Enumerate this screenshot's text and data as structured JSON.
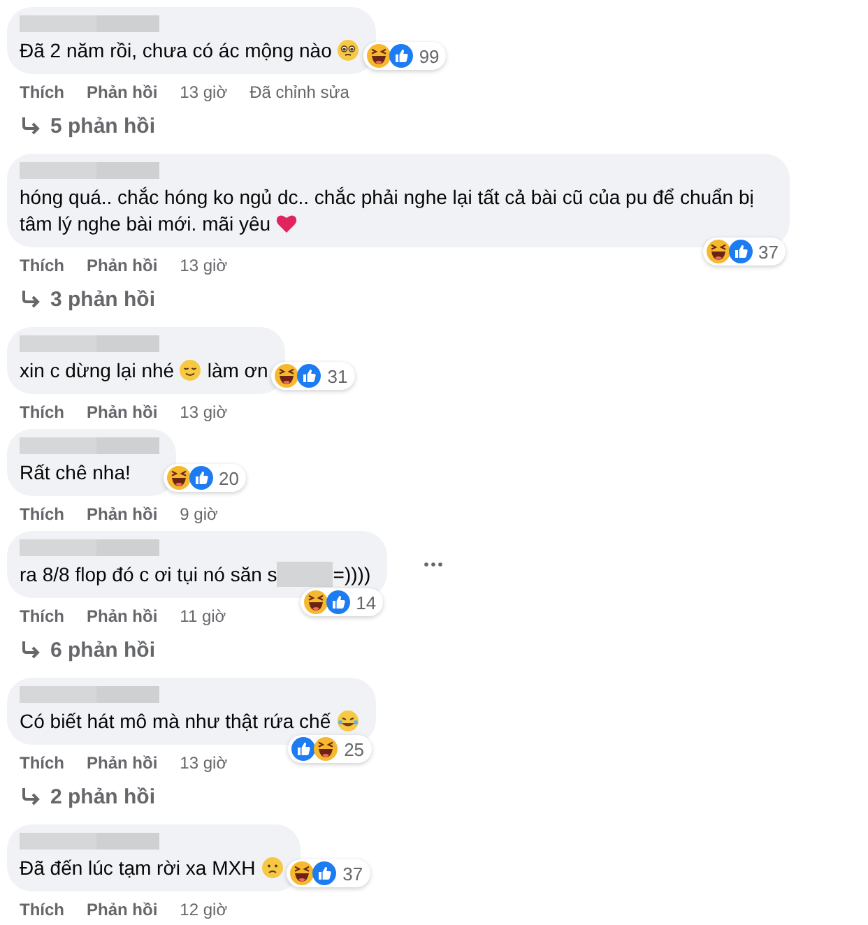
{
  "comments": [
    {
      "parts": [
        {
          "kind": "text",
          "text": "Đã 2 năm rồi, chưa có ác mộng nào "
        },
        {
          "kind": "teary"
        }
      ],
      "reactions": {
        "below": false,
        "icons": [
          {
            "kind": "haha"
          },
          {
            "kind": "like"
          }
        ],
        "count": "99"
      },
      "menu": false,
      "actions": [
        "Thích",
        "Phản hồi"
      ],
      "time": "13 giờ",
      "edited": "Đã chỉnh sửa",
      "replies": "5 phản hồi"
    },
    {
      "parts": [
        {
          "kind": "text",
          "text": "hóng quá.. chắc hóng ko ngủ dc.. chắc phải nghe lại tất cả bài cũ của pu để chuẩn bị "
        },
        {
          "kind": "text",
          "text": "tâm lý nghe bài mới. mãi yêu "
        },
        {
          "kind": "heart"
        }
      ],
      "reactions": {
        "below": true,
        "icons": [
          {
            "kind": "haha"
          },
          {
            "kind": "like"
          }
        ],
        "count": "37"
      },
      "menu": false,
      "actions": [
        "Thích",
        "Phản hồi"
      ],
      "time": "13 giờ",
      "replies": "3 phản hồi"
    },
    {
      "parts": [
        {
          "kind": "text",
          "text": "xin c dừng lại nhé "
        },
        {
          "kind": "relieved"
        },
        {
          "kind": "text",
          "text": " làm ơn"
        }
      ],
      "reactions": {
        "below": false,
        "icons": [
          {
            "kind": "haha"
          },
          {
            "kind": "like"
          }
        ],
        "count": "31"
      },
      "menu": false,
      "actions": [
        "Thích",
        "Phản hồi"
      ],
      "time": "13 giờ"
    },
    {
      "parts": [
        {
          "kind": "text",
          "text": "Rất chê nha!"
        }
      ],
      "reactions": {
        "below": false,
        "icons": [
          {
            "kind": "haha"
          },
          {
            "kind": "like"
          }
        ],
        "count": "20"
      },
      "menu": false,
      "actions": [
        "Thích",
        "Phản hồi"
      ],
      "time": "9 giờ"
    },
    {
      "parts": [
        {
          "kind": "text",
          "text": "ra 8/8 flop đó c ơi tụi nó săn s"
        },
        {
          "kind": "redacted"
        },
        {
          "kind": "text",
          "text": "=))))"
        }
      ],
      "reactions": {
        "below": true,
        "icons": [
          {
            "kind": "haha"
          },
          {
            "kind": "like"
          }
        ],
        "count": "14"
      },
      "menu": true,
      "actions": [
        "Thích",
        "Phản hồi"
      ],
      "time": "11 giờ",
      "replies": "6 phản hồi"
    },
    {
      "parts": [
        {
          "kind": "text",
          "text": "Có biết hát mô mà như thật rứa chế "
        },
        {
          "kind": "rofl"
        }
      ],
      "reactions": {
        "below": true,
        "icons": [
          {
            "kind": "like"
          },
          {
            "kind": "haha"
          }
        ],
        "count": "25"
      },
      "menu": false,
      "actions": [
        "Thích",
        "Phản hồi"
      ],
      "time": "13 giờ",
      "replies": "2 phản hồi"
    },
    {
      "parts": [
        {
          "kind": "text",
          "text": "Đã đến lúc tạm rời xa MXH "
        },
        {
          "kind": "sad"
        }
      ],
      "reactions": {
        "below": false,
        "icons": [
          {
            "kind": "haha"
          },
          {
            "kind": "like"
          }
        ],
        "count": "37"
      },
      "menu": false,
      "actions": [
        "Thích",
        "Phản hồi"
      ],
      "time": "12 giờ"
    }
  ]
}
